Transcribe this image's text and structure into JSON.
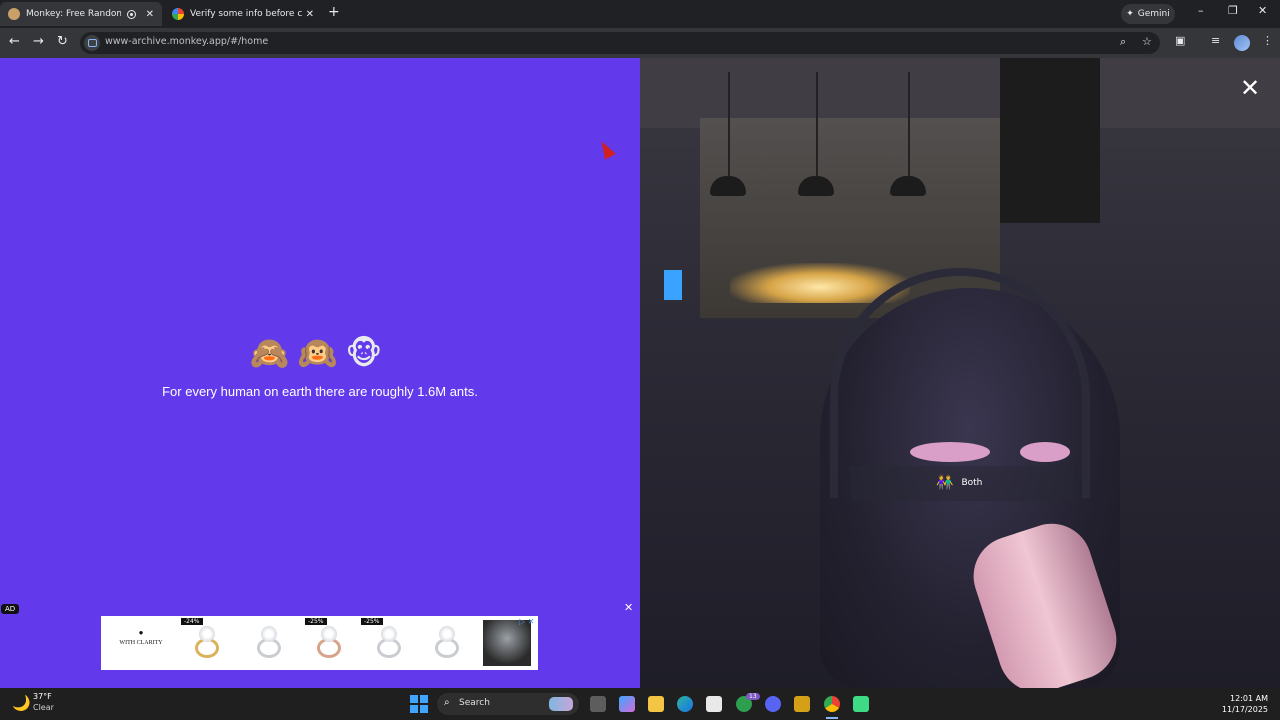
{
  "browser": {
    "tabs": [
      {
        "title": "Monkey: Free Random Vide",
        "active": true
      },
      {
        "title": "Verify some info before creating",
        "active": false
      }
    ],
    "new_tab": "+",
    "gemini_label": "Gemini",
    "window_controls": {
      "minimize": "–",
      "restore": "❐",
      "close": "✕"
    },
    "url": "www-archive.monkey.app/#/home"
  },
  "page": {
    "monkeys": "🙈🙉🐵",
    "fact": "For every human on earth there are roughly 1.6M ants.",
    "ad": {
      "label": "AD",
      "close": "✕",
      "brand": "WITH CLARITY",
      "discounts": [
        "-24%",
        "-25%",
        "-25%"
      ]
    }
  },
  "video": {
    "close": "✕",
    "tag_icon": "👫",
    "tag_label": "Both"
  },
  "taskbar": {
    "temperature": "37°F",
    "condition": "Clear",
    "search_label": "Search",
    "time": "12:01 AM",
    "date": "11/17/2025",
    "badge_count": "13"
  }
}
